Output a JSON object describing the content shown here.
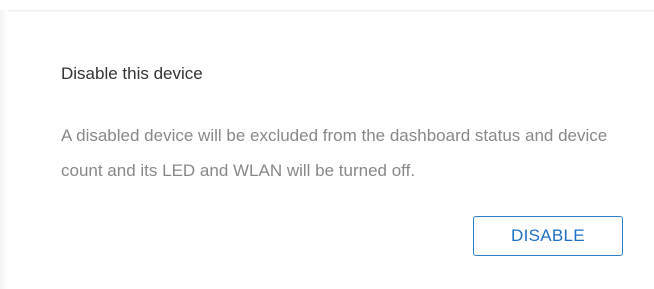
{
  "section": {
    "title": "Disable this device",
    "description": "A disabled device will be excluded from the dashboard status and device count and its LED and WLAN will be turned off.",
    "button_label": "DISABLE"
  },
  "colors": {
    "accent": "#1f6fc4",
    "title_text": "#333333",
    "description_text": "#888888"
  }
}
